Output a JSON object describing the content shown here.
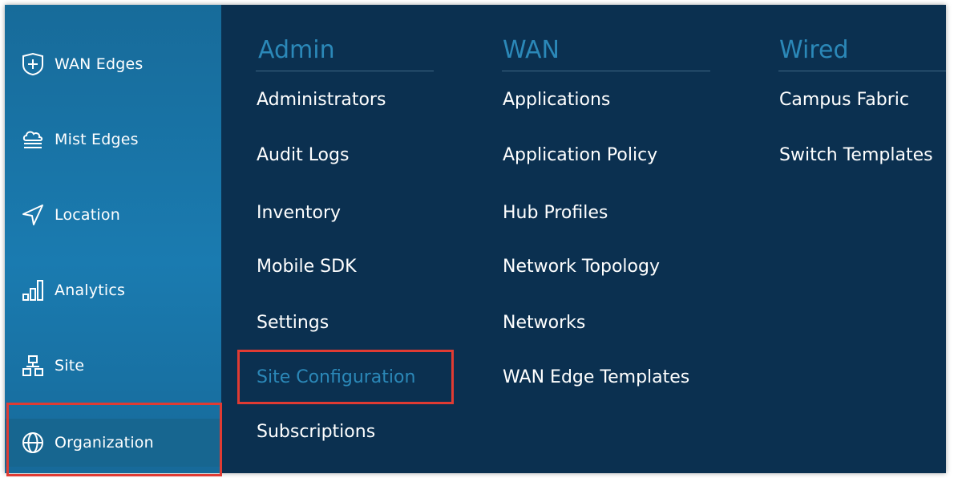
{
  "sidebar": {
    "items": [
      {
        "label": "WAN Edges",
        "icon": "shield-plus-icon"
      },
      {
        "label": "Mist Edges",
        "icon": "cloud-stack-icon"
      },
      {
        "label": "Location",
        "icon": "navigation-arrow-icon"
      },
      {
        "label": "Analytics",
        "icon": "bar-chart-icon"
      },
      {
        "label": "Site",
        "icon": "site-hierarchy-icon"
      },
      {
        "label": "Organization",
        "icon": "globe-icon"
      }
    ],
    "active_item": "Organization"
  },
  "menu": {
    "admin": {
      "header": "Admin",
      "items": [
        "Administrators",
        "Audit Logs",
        "Inventory",
        "Mobile SDK",
        "Settings",
        "Site Configuration",
        "Subscriptions"
      ],
      "selected": "Site Configuration"
    },
    "wan": {
      "header": "WAN",
      "items": [
        "Applications",
        "Application Policy",
        "Hub Profiles",
        "Network Topology",
        "Networks",
        "WAN Edge Templates"
      ]
    },
    "wired": {
      "header": "Wired",
      "items": [
        "Campus Fabric",
        "Switch Templates"
      ]
    }
  },
  "colors": {
    "panel_background": "#0b3050",
    "sidebar_background": "#1a7bb0",
    "header_text": "#2b88b8",
    "highlight_box": "#e03b33"
  }
}
